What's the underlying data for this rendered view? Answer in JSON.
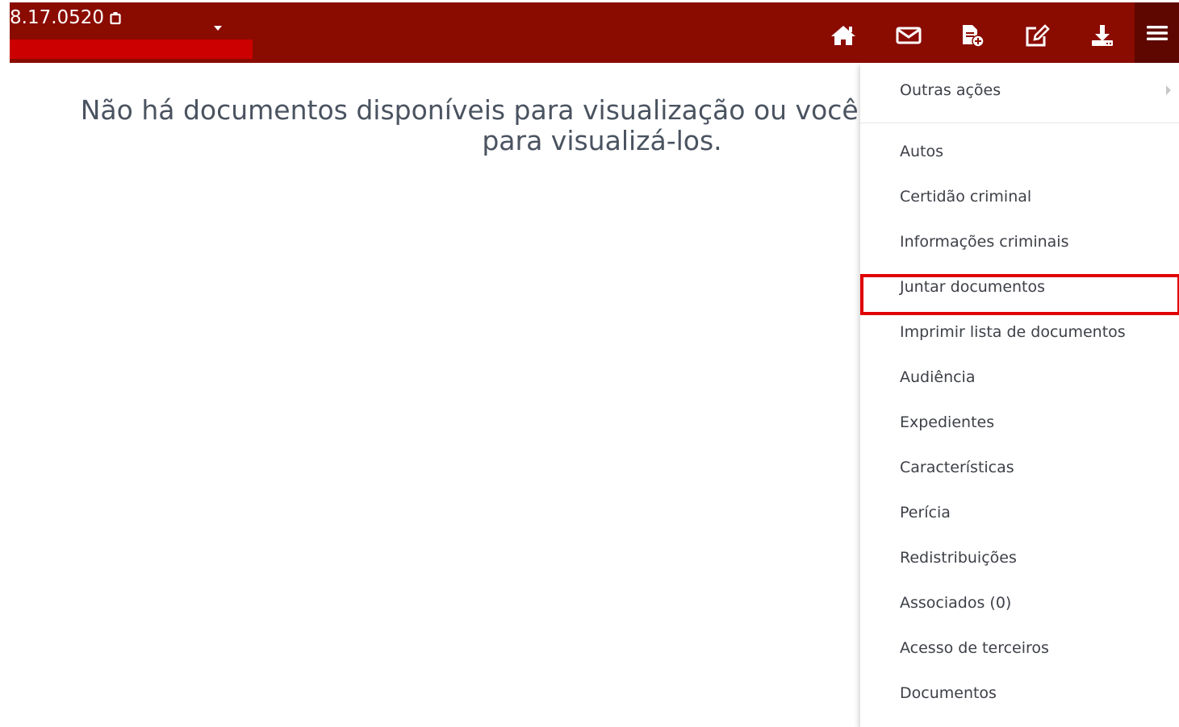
{
  "header": {
    "process_number": "8.17.0520",
    "copy_icon": "copy-icon",
    "tools": [
      {
        "name": "home",
        "icon": "home-icon"
      },
      {
        "name": "mail",
        "icon": "envelope-icon"
      },
      {
        "name": "add-document",
        "icon": "document-add-icon"
      },
      {
        "name": "edit",
        "icon": "edit-icon"
      },
      {
        "name": "download",
        "icon": "download-icon"
      }
    ],
    "menu_icon": "hamburger-menu-icon"
  },
  "main": {
    "message": "Não há documentos disponíveis para visualização ou você não tem permissão para visualizá-los."
  },
  "dropdown": {
    "submenu_label": "Outras ações",
    "items": [
      "Autos",
      "Certidão criminal",
      "Informações criminais",
      "Juntar documentos",
      "Imprimir lista de documentos",
      "Audiência",
      "Expedientes",
      "Características",
      "Perícia",
      "Redistribuições",
      "Associados (0)",
      "Acesso de terceiros",
      "Documentos"
    ],
    "highlighted_item": "Juntar documentos"
  },
  "colors": {
    "header_bg": "#8a0b00",
    "menu_button_bg": "#5e0700",
    "redaction": "#cc0000",
    "highlight_border": "#e00000",
    "message_text": "#4a5360"
  }
}
